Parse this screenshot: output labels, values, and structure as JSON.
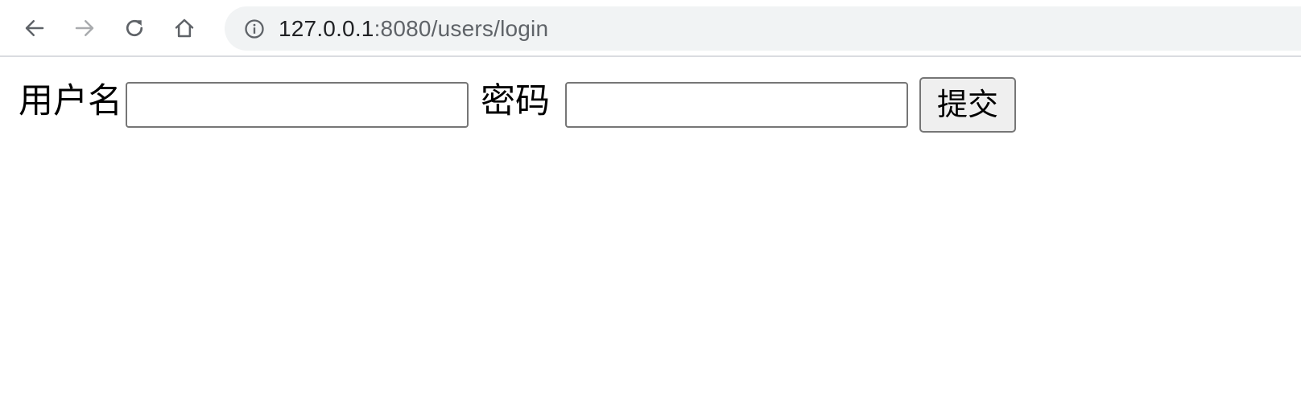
{
  "browser": {
    "url_host": "127.0.0.1",
    "url_rest": ":8080/users/login",
    "icons": {
      "back": "back-arrow-icon",
      "forward": "forward-arrow-icon",
      "reload": "reload-icon",
      "home": "home-icon",
      "info": "info-icon"
    }
  },
  "form": {
    "username_label": "用户名",
    "username_value": "",
    "password_label": "密码",
    "password_value": "",
    "submit_label": "提交"
  }
}
